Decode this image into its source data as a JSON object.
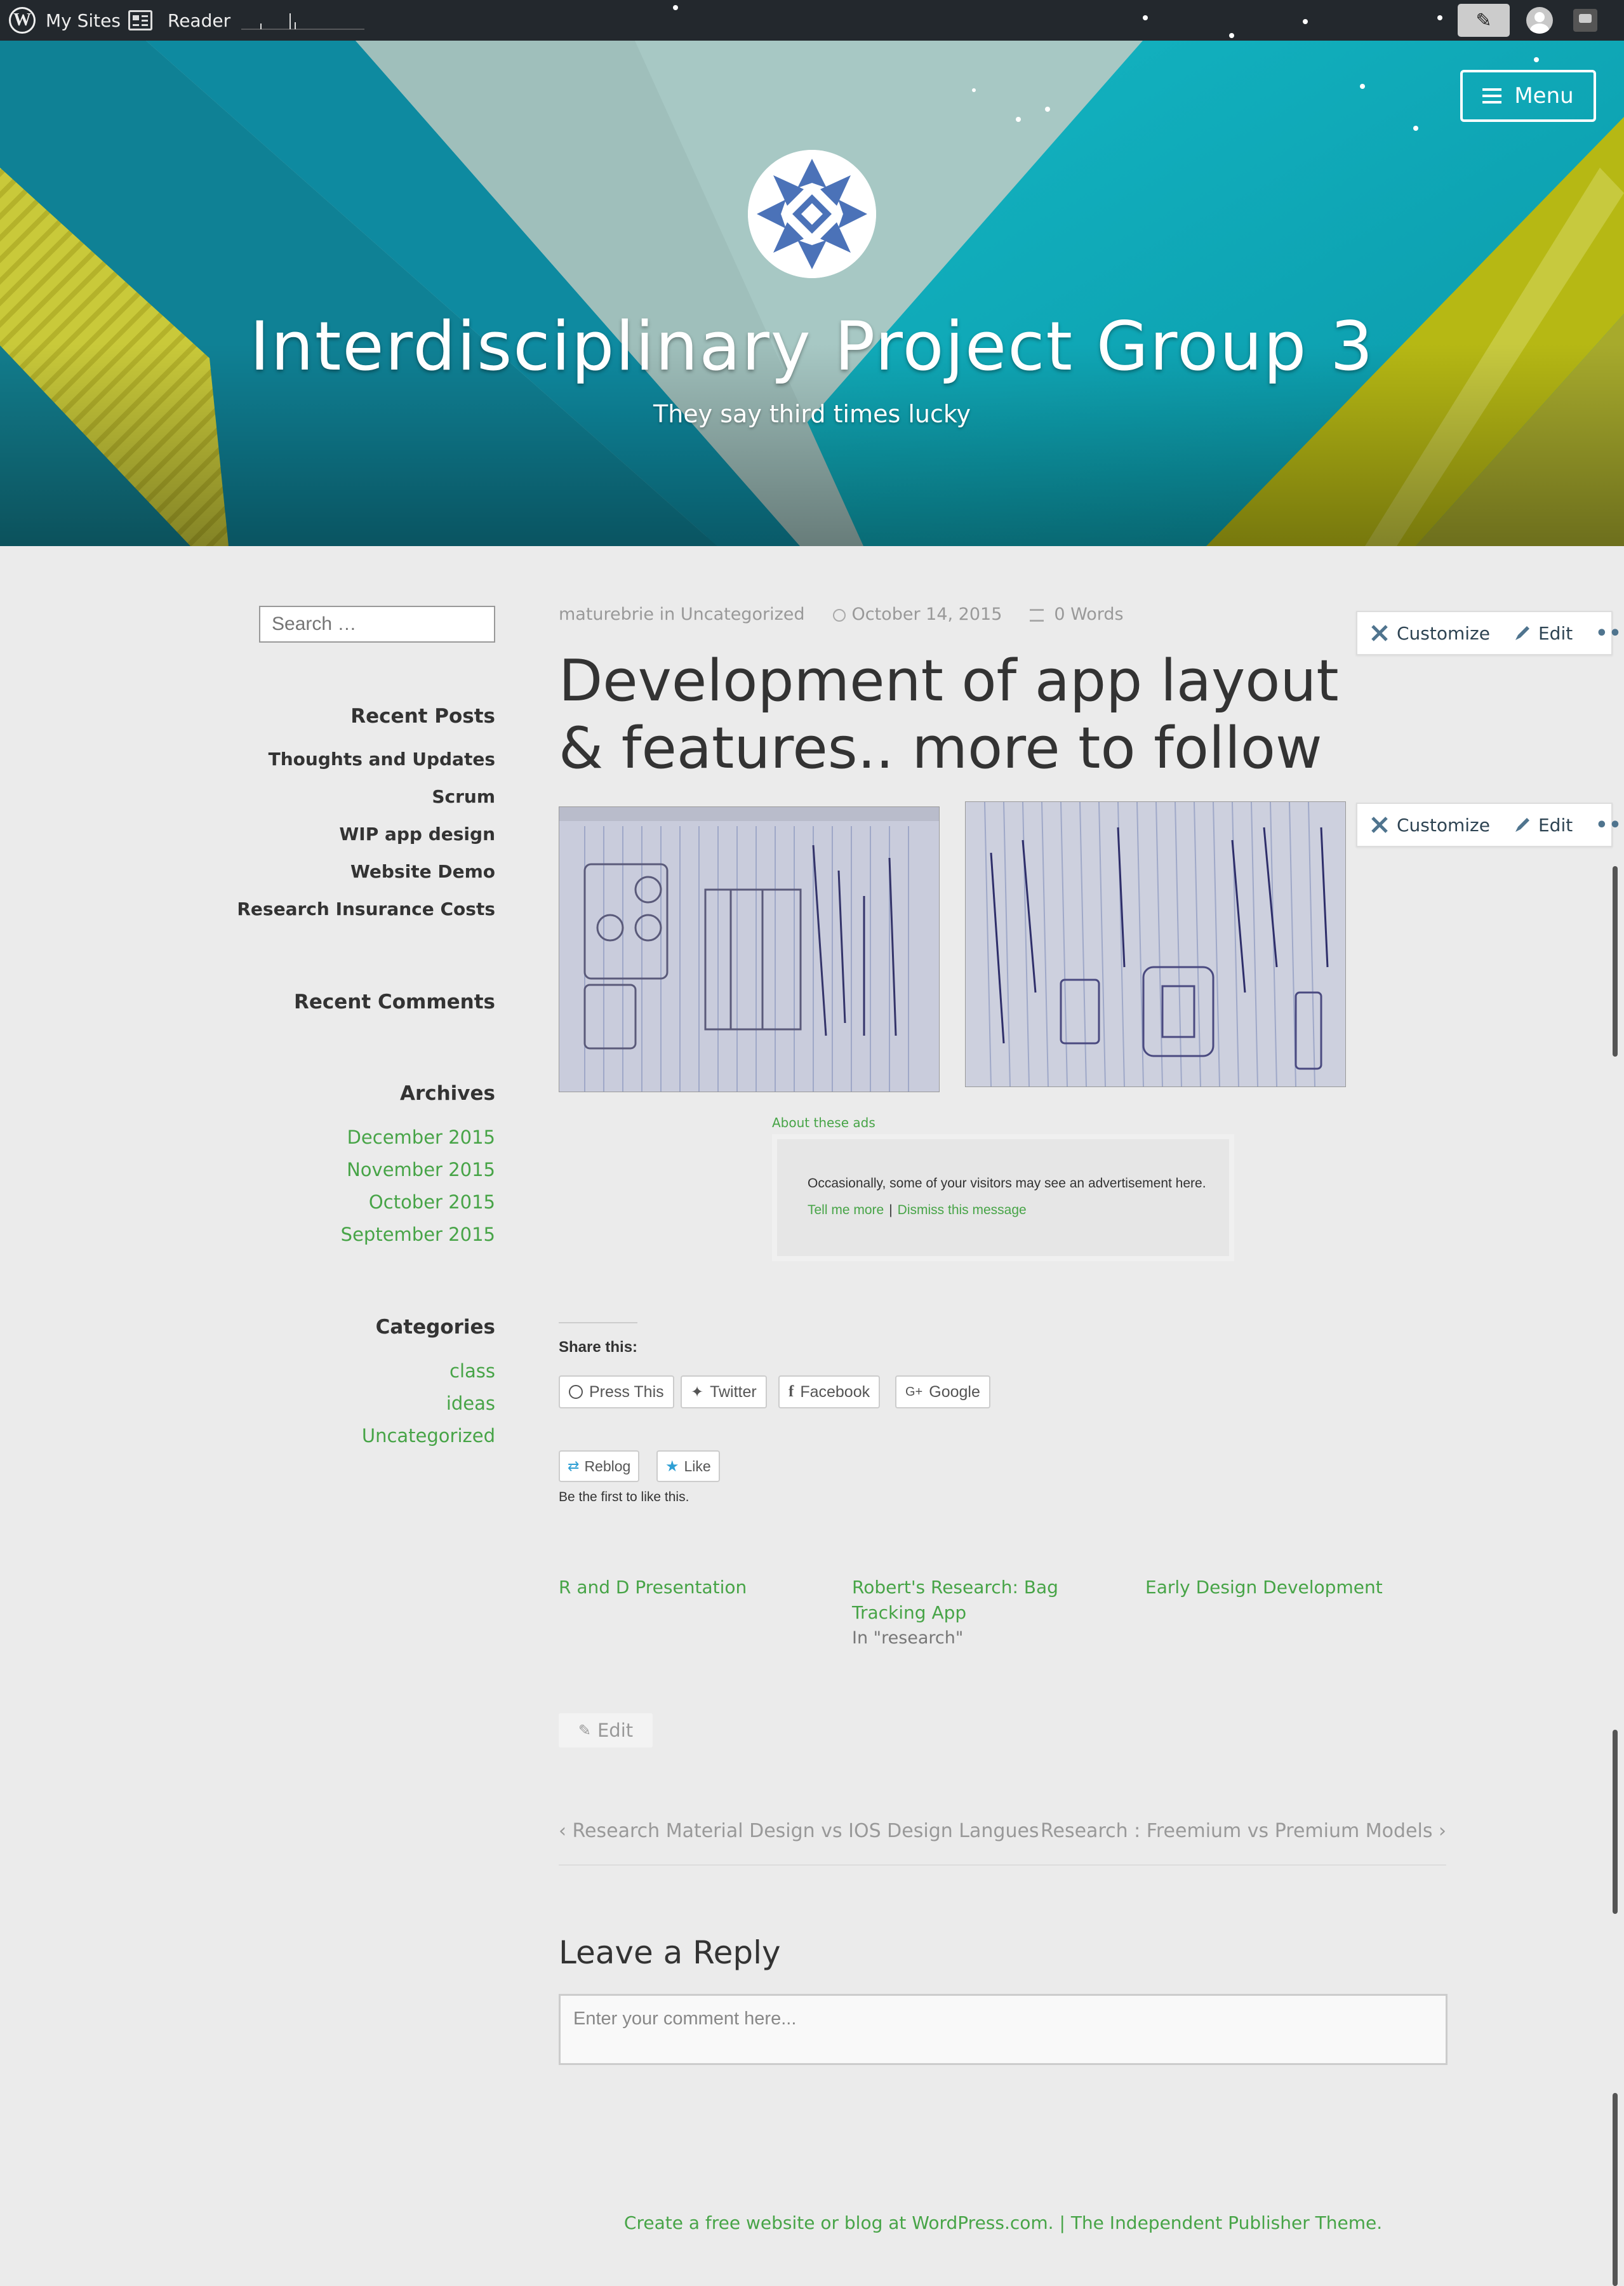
{
  "admin_bar": {
    "my_sites_label": "My Sites",
    "reader_label": "Reader"
  },
  "header": {
    "menu_label": "Menu",
    "site_title": "Interdisciplinary Project Group 3",
    "site_description": "They say third times lucky"
  },
  "sidebar": {
    "search": {
      "placeholder": "Search …"
    },
    "recent_posts": {
      "title": "Recent Posts",
      "items": [
        "Thoughts and Updates",
        "Scrum",
        "WIP app design",
        "Website Demo",
        "Research Insurance Costs"
      ]
    },
    "recent_comments": {
      "title": "Recent Comments"
    },
    "archives": {
      "title": "Archives",
      "items": [
        "December 2015",
        "November 2015",
        "October 2015",
        "September 2015"
      ]
    },
    "categories": {
      "title": "Categories",
      "items": [
        "class",
        "ideas",
        "Uncategorized"
      ]
    }
  },
  "post": {
    "author": "maturebrie",
    "in_label": "in",
    "category": "Uncategorized",
    "date": "October 14, 2015",
    "word_count": "0 Words",
    "title": "Development of app layout & features.. more to follow"
  },
  "customize_bar": {
    "customize_label": "Customize",
    "edit_label": "Edit",
    "more_label": "•••"
  },
  "ads": {
    "about_label": "About these ads",
    "message": "Occasionally, some of your visitors may see an advertisement here.",
    "tell_more": "Tell me more",
    "separator": "|",
    "dismiss": "Dismiss this message"
  },
  "share": {
    "title": "Share this:",
    "buttons": [
      "Press This",
      "Twitter",
      "Facebook",
      "Google"
    ]
  },
  "likes": {
    "reblog_label": "Reblog",
    "like_label": "Like",
    "note": "Be the first to like this."
  },
  "related": [
    {
      "title": "R and D Presentation",
      "context": ""
    },
    {
      "title": "Robert's Research: Bag Tracking App",
      "context": "In \"research\""
    },
    {
      "title": "Early Design Development",
      "context": ""
    }
  ],
  "edit_button_label": "Edit",
  "post_nav": {
    "previous": "Research Material Design vs IOS Design Langues",
    "next": "Research : Freemium vs Premium Models"
  },
  "reply": {
    "title": "Leave a Reply",
    "placeholder": "Enter your comment here..."
  },
  "footer": {
    "link1": "Create a free website or blog at WordPress.com.",
    "separator": "|",
    "link2": "The Independent Publisher Theme."
  },
  "colors": {
    "admin_bar": "#23282d",
    "page_background": "#ebebeb",
    "link_green": "#47a447",
    "header_teal": "#0aa8b8",
    "header_lime": "#b6b814"
  }
}
